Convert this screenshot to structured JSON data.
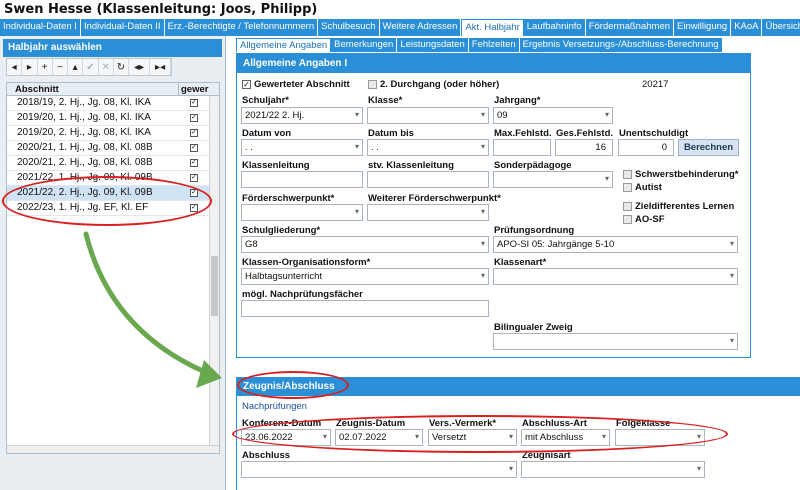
{
  "window_title": "Swen Hesse (Klassenleitung: Joos, Philipp)",
  "main_tabs": [
    "Individual-Daten I",
    "Individual-Daten II",
    "Erz.-Berechtigte / Telefonnummern",
    "Schulbesuch",
    "Weitere Adressen",
    "Akt. Halbjahr",
    "Laufbahninfo",
    "Fördermaßnahmen",
    "Einwilligung",
    "KAoA",
    "Übersicht"
  ],
  "left_panel": {
    "title": "Halbjahr auswählen",
    "toolbar": [
      "◂",
      "▸",
      "+",
      "−",
      "▴",
      "✔",
      "✕",
      "↻",
      "◂▸",
      "▸◂"
    ],
    "columns": [
      "Abschnitt",
      "gewer"
    ],
    "rows": [
      {
        "label": "2018/19, 2. Hj., Jg. 08, Kl. IKA",
        "checked": true
      },
      {
        "label": "2019/20, 1. Hj., Jg. 08, Kl. IKA",
        "checked": true
      },
      {
        "label": "2019/20, 2. Hj., Jg. 08, Kl. IKA",
        "checked": true
      },
      {
        "label": "2020/21, 1. Hj., Jg. 08, Kl. 08B",
        "checked": true
      },
      {
        "label": "2020/21, 2. Hj., Jg. 08, Kl. 08B",
        "checked": true
      },
      {
        "label": "2021/22, 1. Hj., Jg. 09, Kl. 09B",
        "checked": true
      },
      {
        "label": "2021/22, 2. Hj., Jg. 09, Kl. 09B",
        "checked": true
      },
      {
        "label": "2022/23, 1. Hj., Jg. EF, Kl. EF",
        "checked": true
      }
    ]
  },
  "sub_tabs": [
    "Allgemeine Angaben",
    "Bemerkungen",
    "Leistungsdaten",
    "Fehlzeiten",
    "Ergebnis Versetzungs-/Abschluss-Berechnung"
  ],
  "allgemein": {
    "title": "Allgemeine Angaben I",
    "gewerteter_abschnitt": "Gewerteter Abschnitt",
    "zweiter_durchgang": "2. Durchgang (oder höher)",
    "id_number": "20217",
    "schuljahr_label": "Schuljahr*",
    "schuljahr_value": "2021/22 2. Hj.",
    "klasse_label": "Klasse*",
    "klasse_value": "",
    "jahrgang_label": "Jahrgang*",
    "jahrgang_value": "09",
    "datum_von_label": "Datum von",
    "datum_von_value": ". .",
    "datum_bis_label": "Datum bis",
    "datum_bis_value": ". .",
    "max_fehlstd_label": "Max.Fehlstd.",
    "max_fehlstd_value": "",
    "ges_fehlstd_label": "Ges.Fehlstd.",
    "ges_fehlstd_value": "16",
    "unentschuldigt_label": "Unentschuldigt",
    "unentschuldigt_value": "0",
    "berechnen": "Berechnen",
    "klassenleitung_label": "Klassenleitung",
    "stv_klassenleitung_label": "stv. Klassenleitung",
    "sonderpaedagoge_label": "Sonderpädagoge",
    "schwerstbehinderung": "Schwerstbehinderung*",
    "autist": "Autist",
    "foerderschwerpunkt_label": "Förderschwerpunkt*",
    "weiterer_foerderschwerpunkt_label": "Weiterer Förderschwerpunkt*",
    "zieldifferentes_lernen": "Zieldifferentes Lernen",
    "ao_sf": "AO-SF",
    "schulgliederung_label": "Schulgliederung*",
    "schulgliederung_value": "G8",
    "pruefungsordnung_label": "Prüfungsordnung",
    "pruefungsordnung_value": "APO-SI 05: Jahrgänge 5-10",
    "klassen_org_label": "Klassen-Organisationsform*",
    "klassen_org_value": "Halbtagsunterricht",
    "klassenart_label": "Klassenart*",
    "nachpruefungsfaecher_label": "mögl. Nachprüfungsfächer",
    "bilingual_label": "Bilingualer Zweig"
  },
  "zeugnis": {
    "title": "Zeugnis/Abschluss",
    "nachpruefungen": "Nachprüfungen",
    "konferenz_label": "Konferenz-Datum",
    "konferenz_value": "23.06.2022",
    "zeugnis_label": "Zeugnis-Datum",
    "zeugnis_value": "02.07.2022",
    "vermerk_label": "Vers.-Vermerk*",
    "vermerk_value": "Versetzt",
    "abschlussart_label": "Abschluss-Art",
    "abschlussart_value": "mit Abschluss",
    "folgeklasse_label": "Folgeklasse",
    "folgeklasse_value": "",
    "abschluss_label": "Abschluss",
    "zeugnisart_label": "Zeugnisart"
  },
  "colors": {
    "accent": "#2a8fd6",
    "annotation": "#d92020",
    "arrow": "#6aa84f"
  }
}
